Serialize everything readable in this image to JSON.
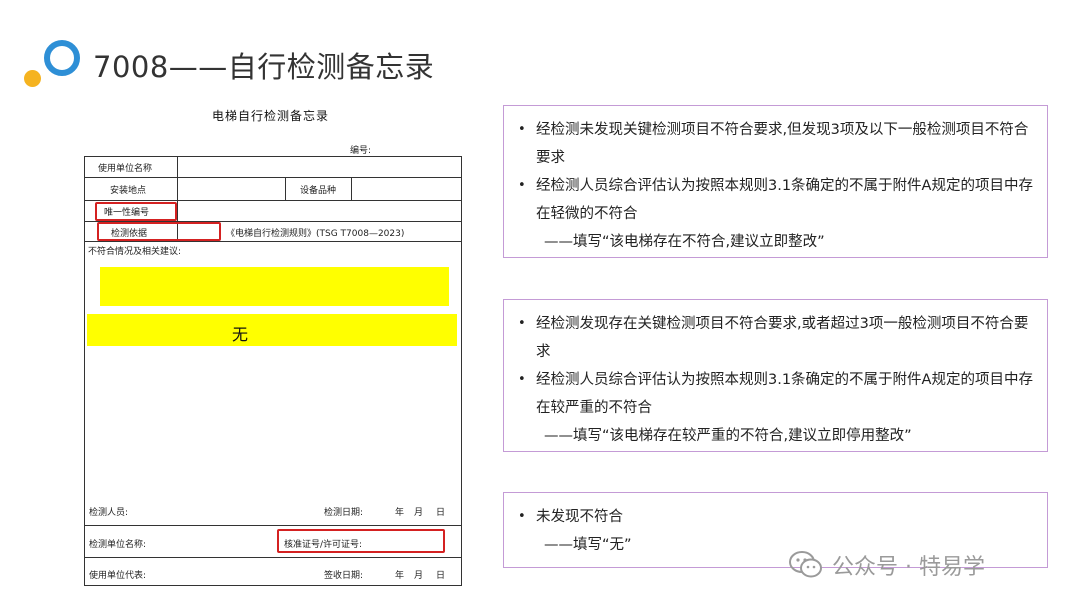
{
  "slide": {
    "title": "7008——自行检测备忘录"
  },
  "form": {
    "title": "电梯自行检测备忘录",
    "number_label": "编号:",
    "use_unit_name": "使用单位名称",
    "install_location": "安装地点",
    "equipment_type": "设备品种",
    "unique_id": "唯一性编号",
    "basis_label": "检测依据",
    "basis_value": "《电梯自行检测规则》(TSG T7008—2023)",
    "nonconformity": "不符合情况及相关建议:",
    "none_text": "无",
    "inspector": "检测人员:",
    "inspect_date": "检测日期:",
    "year": "年",
    "month": "月",
    "day": "日",
    "unit_name": "检测单位名称:",
    "license": "核准证号/许可证号:",
    "use_rep": "使用单位代表:",
    "sign_date": "签收日期:"
  },
  "boxes": [
    {
      "bullets": [
        "经检测未发现关键检测项目不符合要求,但发现3项及以下一般检测项目不符合要求",
        "经检测人员综合评估认为按照本规则3.1条确定的不属于附件A规定的项目中存在轻微的不符合"
      ],
      "fill": "——填写“该电梯存在不符合,建议立即整改”"
    },
    {
      "bullets": [
        "经检测发现存在关键检测项目不符合要求,或者超过3项一般检测项目不符合要求",
        "经检测人员综合评估认为按照本规则3.1条确定的不属于附件A规定的项目中存在较严重的不符合"
      ],
      "fill": "——填写“该电梯存在较严重的不符合,建议立即停用整改”"
    },
    {
      "bullets": [
        "未发现不符合"
      ],
      "fill": "——填写“无”"
    }
  ],
  "watermark": {
    "text": "公众号 · 特易学",
    "icon": "wechat-icon"
  }
}
